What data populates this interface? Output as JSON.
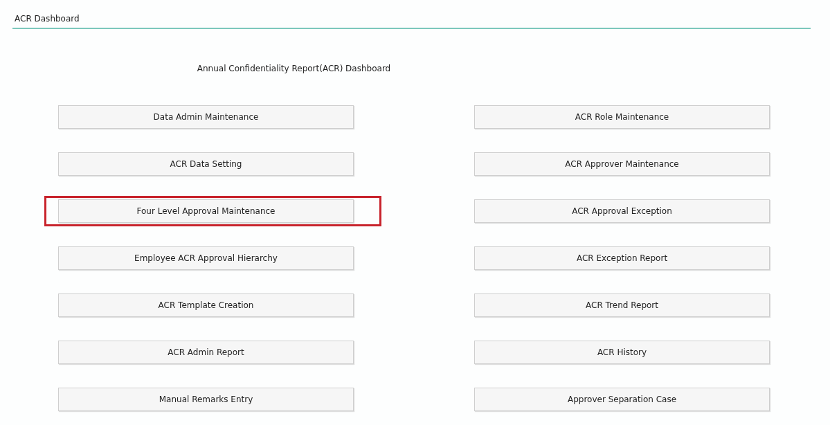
{
  "tab": {
    "label": "ACR Dashboard"
  },
  "heading": "Annual Confidentiality Report(ACR) Dashboard",
  "buttons": [
    {
      "label": "Data Admin Maintenance",
      "highlighted": false
    },
    {
      "label": "ACR Role Maintenance",
      "highlighted": false
    },
    {
      "label": "ACR Data Setting",
      "highlighted": false
    },
    {
      "label": "ACR Approver Maintenance",
      "highlighted": false
    },
    {
      "label": "Four Level Approval Maintenance",
      "highlighted": true
    },
    {
      "label": "ACR Approval Exception",
      "highlighted": false
    },
    {
      "label": "Employee ACR Approval Hierarchy",
      "highlighted": false
    },
    {
      "label": "ACR Exception Report",
      "highlighted": false
    },
    {
      "label": "ACR Template Creation",
      "highlighted": false
    },
    {
      "label": "ACR Trend Report",
      "highlighted": false
    },
    {
      "label": "ACR Admin Report",
      "highlighted": false
    },
    {
      "label": "ACR History",
      "highlighted": false
    },
    {
      "label": "Manual Remarks Entry",
      "highlighted": false
    },
    {
      "label": "Approver Separation Case",
      "highlighted": false
    }
  ]
}
